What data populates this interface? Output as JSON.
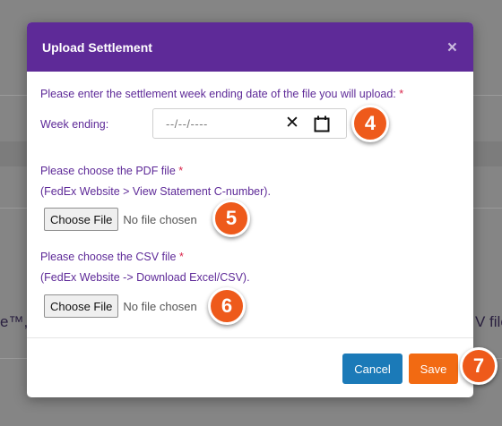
{
  "background": {
    "left_fragment": "e™,",
    "right_fragment": "V file"
  },
  "modal": {
    "title": "Upload Settlement",
    "close_glyph": "×",
    "date_prompt": "Please enter the settlement week ending date of the file you will upload:",
    "required_mark": "*",
    "week_label": "Week ending:",
    "date_placeholder": "--/--/----",
    "date_clear_glyph": "✕",
    "pdf_prompt": "Please choose the PDF file",
    "pdf_hint": "(FedEx Website > View Statement C-number).",
    "csv_prompt": "Please choose the CSV file",
    "csv_hint": "(FedEx Website -> Download Excel/CSV).",
    "choose_file_label": "Choose File",
    "no_file_text": "No file chosen",
    "cancel_label": "Cancel",
    "save_label": "Save"
  },
  "steps": {
    "date": "4",
    "pdf": "5",
    "csv": "6",
    "save": "7"
  },
  "colors": {
    "header": "#5e2a98",
    "prompt_text": "#5e2a98",
    "required": "#d9254a",
    "cancel": "#1b7ab8",
    "save": "#f26a12",
    "step_badge": "#ee5a1b"
  },
  "icons": {
    "close": "close-icon",
    "clear": "clear-date-icon",
    "calendar": "calendar-icon"
  }
}
